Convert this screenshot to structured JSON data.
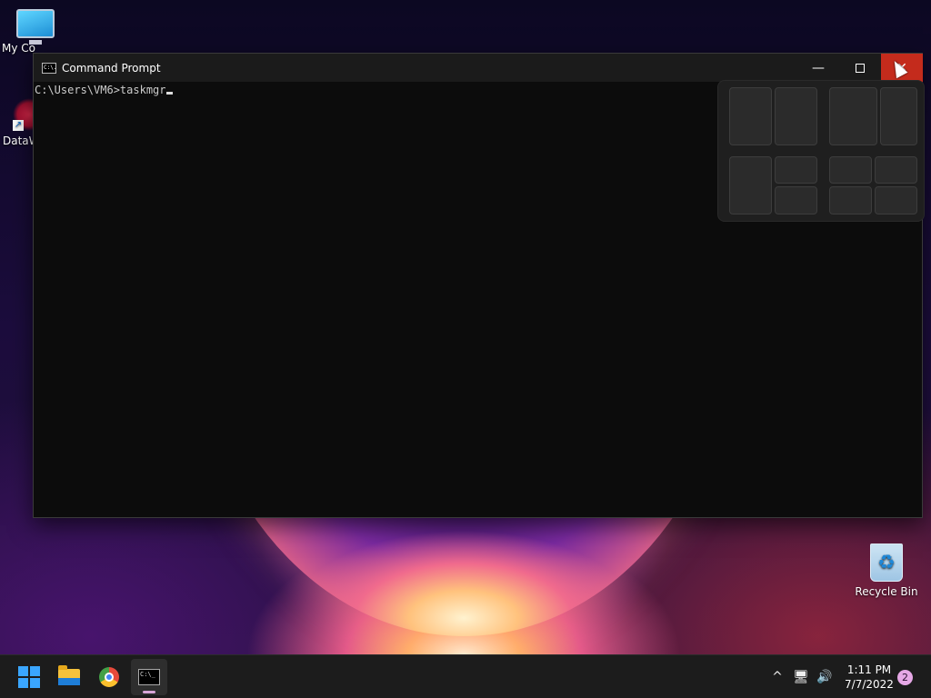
{
  "desktop": {
    "icons": [
      {
        "label": "My Co",
        "icon": "computer-icon"
      },
      {
        "label": "DataW",
        "icon": "datawrapper-icon"
      },
      {
        "label": "Recycle Bin",
        "icon": "recycle-bin-icon"
      }
    ],
    "shortcut_arrow": "↗",
    "recycle_glyph": "♻"
  },
  "cmd_window": {
    "title": "Command Prompt",
    "icon_text": "C:\\.",
    "console_line": "C:\\Users\\VM6>taskmgr",
    "buttons": {
      "minimize": "—",
      "close": "✕"
    }
  },
  "taskbar": {
    "apps": [
      {
        "name": "Start",
        "icon": "windows-logo-icon"
      },
      {
        "name": "File Explorer",
        "icon": "folder-icon"
      },
      {
        "name": "Google Chrome",
        "icon": "chrome-icon"
      },
      {
        "name": "Command Prompt",
        "icon": "cmd-icon",
        "active": true
      }
    ],
    "cmd_icon_text": "C:\\_",
    "tray": {
      "chevron": "^",
      "network": "🖥",
      "volume": "🔊"
    },
    "clock": {
      "time": "1:11 PM",
      "date": "7/7/2022"
    },
    "notification_count": "2"
  },
  "colors": {
    "close_button": "#c42b1c",
    "console_bg": "#0c0c0c",
    "taskbar_bg": "#1c1c1c"
  }
}
